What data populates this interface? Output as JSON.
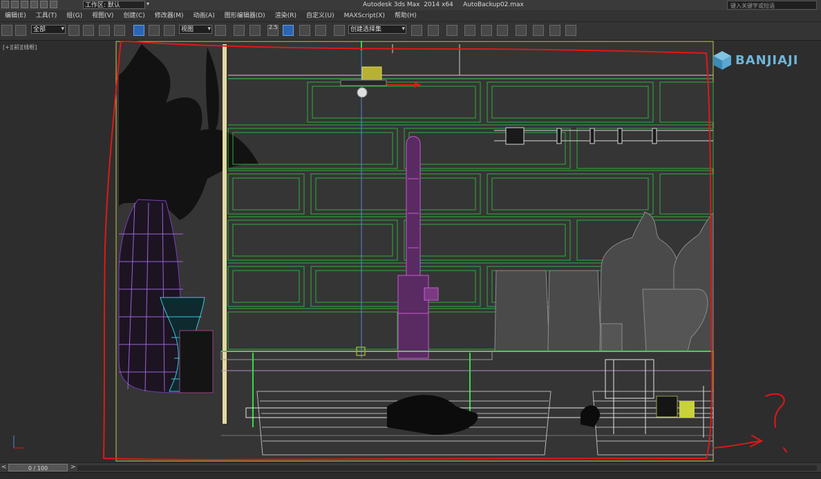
{
  "titlebar": {
    "workspace_label": "工作区: 默认",
    "app_title": "Autodesk 3ds Max  2014 x64     AutoBackup02.max",
    "search_placeholder": "键入关键字或短语"
  },
  "menu": {
    "items": [
      "编辑(E)",
      "工具(T)",
      "组(G)",
      "视图(V)",
      "创建(C)",
      "修改器(M)",
      "动画(A)",
      "图形编辑器(D)",
      "渲染(R)",
      "自定义(U)",
      "MAXScript(X)",
      "帮助(H)"
    ]
  },
  "toolbar": {
    "filter_value": "全部",
    "refcoord_value": "视图",
    "snap_label": "2.5",
    "selection_set_value": "创建选择集"
  },
  "viewport": {
    "label": "[+][前][线框]",
    "watermark": "BANJIAJI",
    "colors": {
      "green": "#2fae3a",
      "magenta": "#c85ad2",
      "purple": "#8a5ac8",
      "cyan": "#3ac8d8",
      "gray": "#8c8c8c",
      "white": "#d8d8d8",
      "red_annotation": "#e01818",
      "yellow": "#d6d23a"
    }
  },
  "timeline": {
    "frame_label": "0 / 100"
  }
}
